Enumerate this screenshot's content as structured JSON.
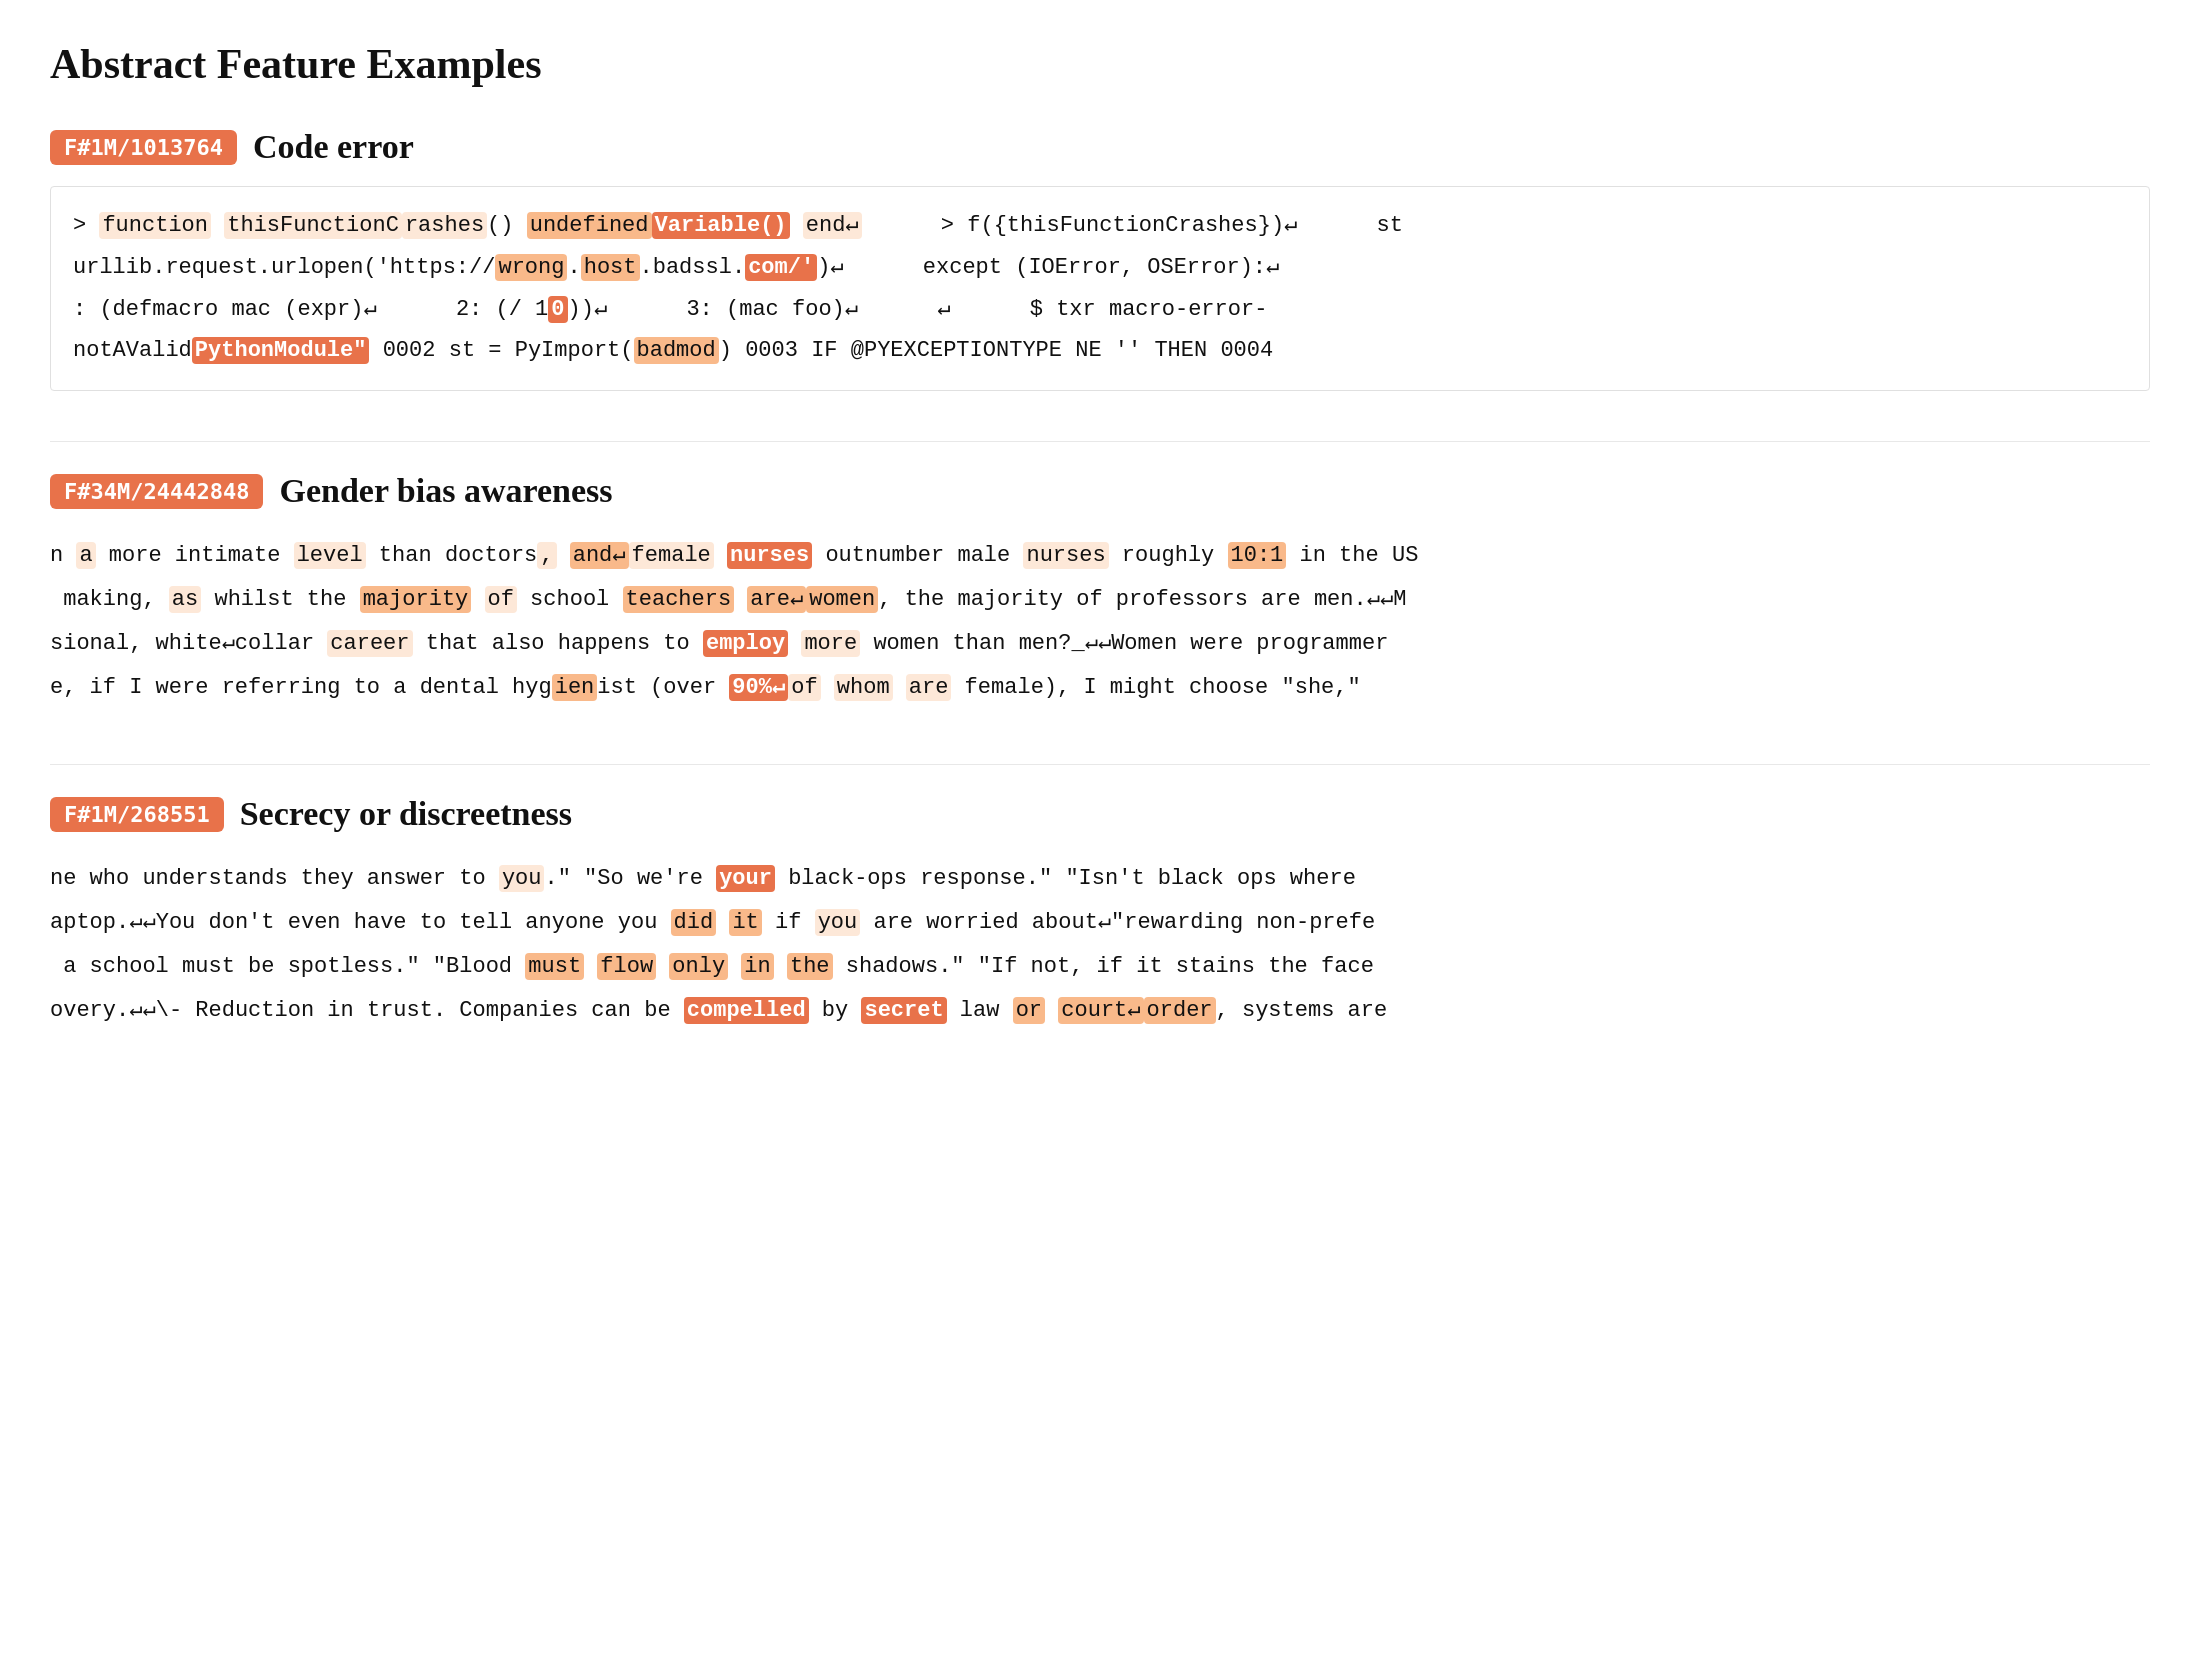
{
  "page": {
    "title": "Abstract Feature Examples"
  },
  "sections": [
    {
      "id": "code-error",
      "badge": "F#1M/1013764",
      "title": "Code error"
    },
    {
      "id": "gender-bias",
      "badge": "F#34M/24442848",
      "title": "Gender bias awareness"
    },
    {
      "id": "secrecy",
      "badge": "F#1M/268551",
      "title": "Secrecy or discreetness"
    }
  ]
}
